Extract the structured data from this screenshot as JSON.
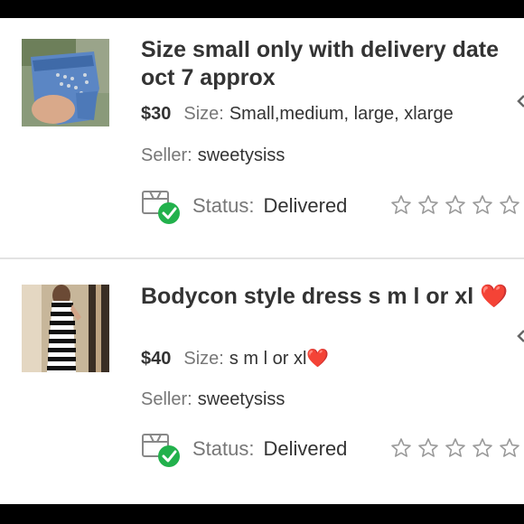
{
  "items": [
    {
      "title": "Size small only with delivery date oct 7 approx",
      "price": "$30",
      "size_label": "Size:",
      "size_value": "Small,medium, large, xlarge",
      "seller_label": "Seller:",
      "seller_name": "sweetysiss",
      "status_label": "Status:",
      "status_value": "Delivered",
      "rating_stars": 5,
      "thumbnail": "denim-shorts-photo"
    },
    {
      "title": "Bodycon style dress s m l or xl",
      "title_emoji": "❤️",
      "price": "$40",
      "size_label": "Size:",
      "size_value": "s m l or xl",
      "size_emoji": "❤️",
      "seller_label": "Seller:",
      "seller_name": "sweetysiss",
      "status_label": "Status:",
      "status_value": "Delivered",
      "rating_stars": 5,
      "thumbnail": "striped-dress-photo"
    }
  ],
  "colors": {
    "check_green": "#22b14c",
    "heart_red": "#e0202e",
    "text_dark": "#333333",
    "text_muted": "#777777"
  }
}
